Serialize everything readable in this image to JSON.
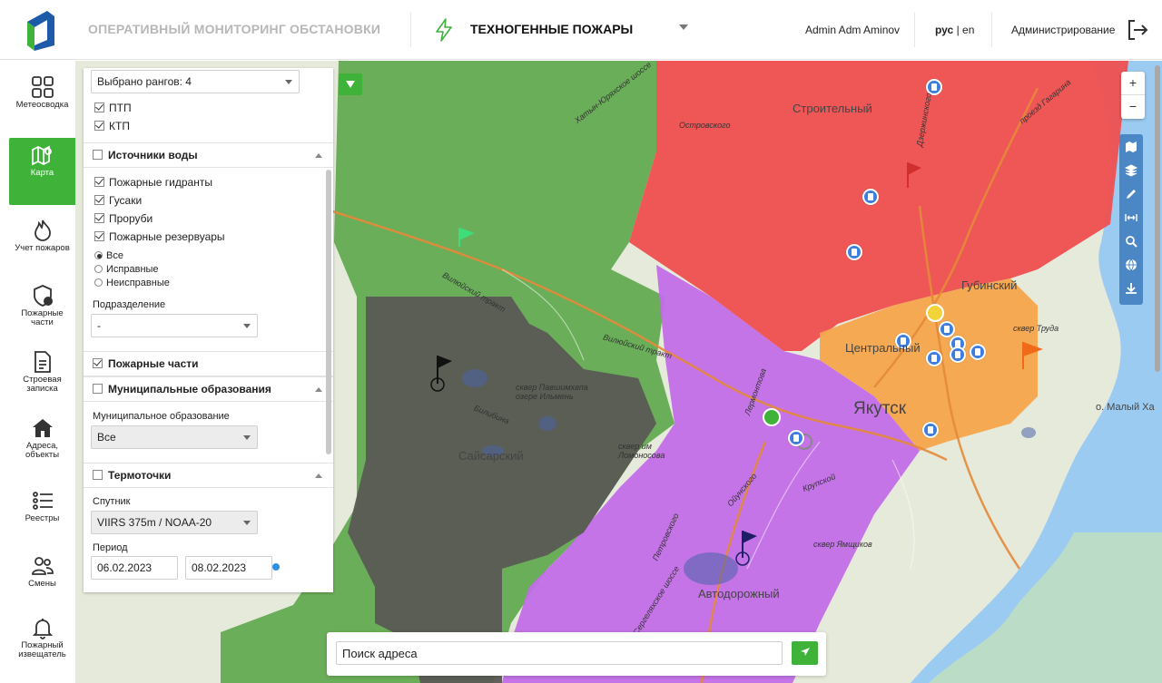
{
  "header": {
    "app_title": "ОПЕРАТИВНЫЙ МОНИТОРИНГ ОБСТАНОВКИ",
    "mode_title": "ТЕХНОГЕННЫЕ ПОЖАРЫ",
    "user_name": "Admin Adm Aminov",
    "lang_ru": "рус",
    "lang_sep": " | ",
    "lang_en": "en",
    "admin_label": "Администрирование"
  },
  "sidebar": {
    "items": [
      {
        "label": "Метеосводка",
        "icon": "grid-icon"
      },
      {
        "label": "Карта",
        "icon": "map-icon"
      },
      {
        "label": "Учет пожаров",
        "icon": "fire-icon"
      },
      {
        "label": "Пожарные части",
        "icon": "shield-icon"
      },
      {
        "label": "Строевая записка",
        "icon": "document-icon"
      },
      {
        "label": "Адреса, объекты",
        "icon": "home-icon"
      },
      {
        "label": "Реестры",
        "icon": "list-icon"
      },
      {
        "label": "Смены",
        "icon": "people-icon"
      },
      {
        "label": "Пожарный извещатель",
        "icon": "bell-icon"
      }
    ]
  },
  "panel": {
    "ranks_select": "Выбрано рангов: 4",
    "ptp": "ПТП",
    "ktp": "КТП",
    "water_sources": {
      "title": "Источники воды",
      "items": [
        "Пожарные гидранты",
        "Гусаки",
        "Проруби",
        "Пожарные резервуары"
      ],
      "radios": [
        "Все",
        "Исправные",
        "Неисправные"
      ],
      "division_label": "Подразделение",
      "division_value": "-"
    },
    "fire_stations": "Пожарные части",
    "municipal": {
      "title": "Муниципальные образования",
      "field_label": "Муниципальное образование",
      "value": "Все"
    },
    "thermal": {
      "title": "Термоточки",
      "satellite_label": "Спутник",
      "satellite_value": "VIIRS 375m / NOAA-20",
      "period_label": "Период",
      "date_from": "06.02.2023",
      "date_to": "08.02.2023"
    }
  },
  "map": {
    "labels": {
      "stroitelny": "Строительный",
      "gubinsky": "Губинский",
      "centralny": "Центральный",
      "yakutsk": "Якутск",
      "saysarsky": "Сайсарский",
      "avtodorozhny": "Автодорожный",
      "maly": "о. Малый Ха"
    },
    "streets": {
      "khatyn": "Хатын-Юряхское шоссе",
      "vilyuy1": "Вилюйский тракт",
      "vilyuy2": "Вилюйский тракт",
      "bilibina": "Билибина",
      "ilmen": "сквер Павшимхвпа озере Ильмень",
      "lomonosova": "сквер им Ломоносова",
      "lermontova": "Лермонтова",
      "oyunskogo": "Ойунского",
      "kruzkoy": "Крупской",
      "yamschikov": "сквер Ямщиков",
      "trud": "сквер Труда",
      "sergel": "Сергеляхское шоссе",
      "petrovskogo": "Петровского",
      "dzerzhinskogo": "Дзержинского",
      "gagarina": "проезд Гагарина",
      "ostrovskogo": "Островского"
    },
    "colors": {
      "green": "#5fa84e",
      "red": "#ef4f4f",
      "orange": "#f5a54b",
      "purple": "#c26ee8",
      "dark": "#5b5a55",
      "river": "#9ccbf1",
      "accent": "#3fb23a",
      "tools": "#4b87c4"
    }
  },
  "search": {
    "placeholder": "Поиск адреса"
  },
  "zoom": {
    "plus": "+",
    "minus": "−"
  }
}
